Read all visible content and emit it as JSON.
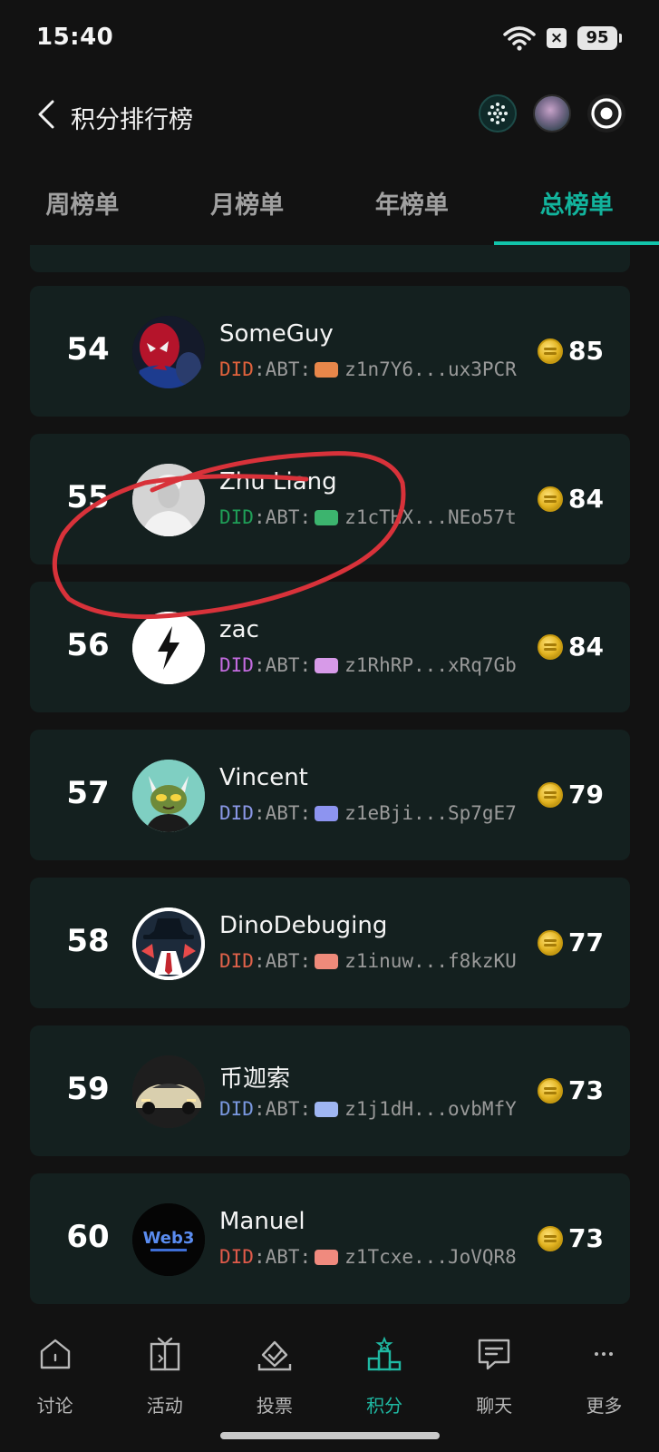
{
  "status_bar": {
    "time": "15:40",
    "battery": "95",
    "x_badge": "×"
  },
  "header": {
    "title": "积分排行榜"
  },
  "tabs": [
    {
      "label": "周榜单",
      "active": false
    },
    {
      "label": "月榜单",
      "active": false
    },
    {
      "label": "年榜单",
      "active": false
    },
    {
      "label": "总榜单",
      "active": true
    }
  ],
  "did": {
    "prefix": "DID",
    "sep": ":",
    "chain": "ABT:"
  },
  "leaderboard": [
    {
      "rank": "54",
      "name": "SomeGuy",
      "did": "z1n7Y6...ux3PCR",
      "points": "85",
      "did_color": "#e0623c",
      "chip_color": "#e8874a"
    },
    {
      "rank": "55",
      "name": "Zhu Liang",
      "did": "z1cTHX...NEo57t",
      "points": "84",
      "did_color": "#1f9e57",
      "chip_color": "#3cb46e"
    },
    {
      "rank": "56",
      "name": "zac",
      "did": "z1RhRP...xRq7Gb",
      "points": "84",
      "did_color": "#c46be0",
      "chip_color": "#d79ae8"
    },
    {
      "rank": "57",
      "name": "Vincent",
      "did": "z1eBji...Sp7gE7",
      "points": "79",
      "did_color": "#8a97e6",
      "chip_color": "#8d94f0"
    },
    {
      "rank": "58",
      "name": "DinoDebuging",
      "did": "z1inuw...f8kzKU",
      "points": "77",
      "did_color": "#e0624a",
      "chip_color": "#ee8a7a"
    },
    {
      "rank": "59",
      "name": "币迦索",
      "did": "z1j1dH...ovbMfY",
      "points": "73",
      "did_color": "#7a98e0",
      "chip_color": "#9fb6f2"
    },
    {
      "rank": "60",
      "name": "Manuel",
      "did": "z1Tcxe...JoVQR8",
      "points": "73",
      "did_color": "#e05a4a",
      "chip_color": "#f08a7e"
    }
  ],
  "avatars": {
    "60_text": "Web3"
  },
  "bottom_nav": [
    {
      "label": "讨论",
      "icon": "house-icon",
      "active": false
    },
    {
      "label": "活动",
      "icon": "gift-icon",
      "active": false
    },
    {
      "label": "投票",
      "icon": "vote-icon",
      "active": false
    },
    {
      "label": "积分",
      "icon": "podium-icon",
      "active": true
    },
    {
      "label": "聊天",
      "icon": "chat-icon",
      "active": false
    },
    {
      "label": "更多",
      "icon": "more-icon",
      "active": false
    }
  ],
  "colors": {
    "accent": "#12c4aa",
    "card_bg": "#14201f",
    "annotation": "#d8323a"
  }
}
